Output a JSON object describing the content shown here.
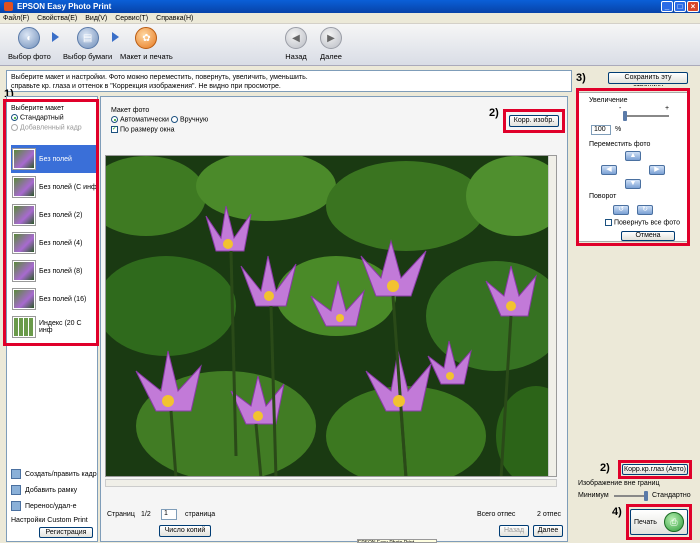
{
  "window": {
    "title": "EPSON Easy Photo Print",
    "min": "_",
    "max": "□",
    "close": "×"
  },
  "menu": [
    "Файл(F)",
    "Свойства(E)",
    "Вид(V)",
    "Сервис(T)",
    "Справка(H)"
  ],
  "toolbar": {
    "select_photo": "Выбор фото",
    "select_paper": "Выбор бумаги",
    "layout_print": "Макет и печать",
    "back": "Назад",
    "next": "Далее"
  },
  "instructions": {
    "line1": "Выберите макет и настройки. Фото можно переместить, повернуть, увеличить, уменьшить.",
    "line2": "справьте кр. глаза и оттенок в \"Коррекция изображения\". Не видно при просмотре."
  },
  "save_page": "Сохранить эту страницу",
  "annotations": {
    "a1": "1)",
    "a2": "2)",
    "a3": "3)",
    "a2b": "2)",
    "a4": "4)"
  },
  "left": {
    "choose_layout": "Выберите макет",
    "standard": "Стандартный",
    "added_frame": "Добавленный кадр",
    "layouts": [
      {
        "label": "Без полей"
      },
      {
        "label": "Без полей (С инф"
      },
      {
        "label": "Без полей (2)"
      },
      {
        "label": "Без полей (4)"
      },
      {
        "label": "Без полей (8)"
      },
      {
        "label": "Без полей (16)"
      },
      {
        "label": "Индекс (20 С инф"
      }
    ],
    "create_frame": "Создать/править кадр",
    "add_frame": "Добавить рамку",
    "move_delete": "Перенос/удал-е",
    "custom_print": "Настройки Custom Print",
    "register": "Регистрация"
  },
  "center": {
    "photo_layout": "Макет фото",
    "automatic": "Автоматически",
    "manual": "Вручную",
    "fit_window": "По размеру окна",
    "corr_image": "Корр. изобр.",
    "page_label": "Страниц",
    "page_value": "1/2",
    "page_input": "1",
    "page_unit": "страница",
    "copies": "Число копий",
    "total_label": "Всего отпес",
    "total_value": "2 отпес",
    "back": "Назад",
    "next": "Далее",
    "tooltip": "EPSON Easy Photo Print"
  },
  "right": {
    "zoom": "Увеличение",
    "zoom_minus": "-",
    "zoom_plus": "+",
    "zoom_value": "100",
    "zoom_unit": "%",
    "move_photo": "Переместить фото",
    "rotate": "Поворот",
    "rotate_all": "Повернуть все фото",
    "cancel": "Отмена",
    "red_eye": "Корр.кр.глаз (Авто)",
    "outside": "Изображение вне границ",
    "minimum": "Минимум",
    "standard": "Стандартно",
    "print": "Печать"
  },
  "colors": {
    "accent_red": "#e0002a",
    "selection": "#3a6fd8",
    "title_blue": "#0a5fd8"
  }
}
